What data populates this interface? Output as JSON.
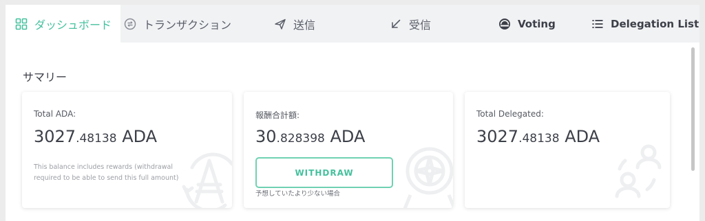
{
  "tabs": [
    {
      "label": "ダッシュボード",
      "icon": "dashboard-grid-icon",
      "active": true
    },
    {
      "label": "トランザクション",
      "icon": "transactions-icon",
      "active": false
    },
    {
      "label": "送信",
      "icon": "send-icon",
      "active": false
    },
    {
      "label": "受信",
      "icon": "receive-icon",
      "active": false
    },
    {
      "label": "Voting",
      "icon": "voting-icon",
      "active": false
    },
    {
      "label": "Delegation List",
      "icon": "list-icon",
      "active": false
    }
  ],
  "summary": {
    "title": "サマリー",
    "cards": [
      {
        "label": "Total ADA:",
        "amount_int": "3027",
        "amount_dec": ".48138",
        "unit": " ADA",
        "note": "This balance includes rewards (withdrawal required to be able to send this full amount)",
        "bg_icon": "ada-coin-icon"
      },
      {
        "label": "報酬合計額:",
        "amount_int": "30",
        "amount_dec": ".828398",
        "unit": " ADA",
        "button": "WITHDRAW",
        "sub_note": "予想していたより少ない場合",
        "bg_icon": "compass-icon"
      },
      {
        "label": "Total Delegated:",
        "amount_int": "3027",
        "amount_dec": ".48138",
        "unit": " ADA",
        "bg_icon": "delegators-icon"
      }
    ]
  },
  "colors": {
    "accent": "#45c19d",
    "text": "#3c3f48",
    "tab_bar": "#f1f2f4",
    "page_bg": "#ececec"
  }
}
